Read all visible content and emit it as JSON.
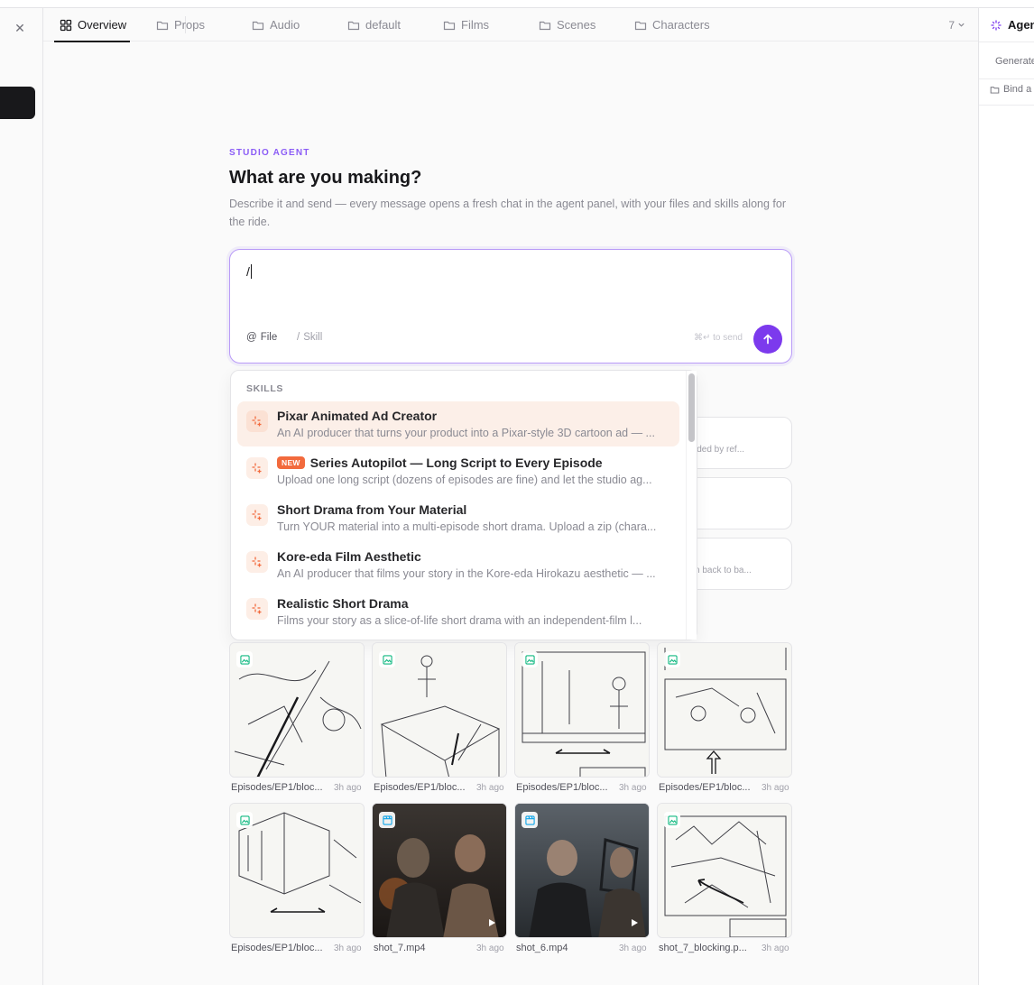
{
  "tabs": [
    {
      "label": "Overview",
      "icon": "grid-icon",
      "active": true
    },
    {
      "label": "Props",
      "icon": "folder-icon"
    },
    {
      "label": "Audio",
      "icon": "folder-icon"
    },
    {
      "label": "default",
      "icon": "folder-icon"
    },
    {
      "label": "Films",
      "icon": "folder-icon"
    },
    {
      "label": "Scenes",
      "icon": "folder-icon"
    },
    {
      "label": "Characters",
      "icon": "folder-icon"
    }
  ],
  "tab_overflow_count": "7",
  "right_panel": {
    "title": "Agent",
    "generate_label": "Generate",
    "bind_label": "Bind a"
  },
  "hero": {
    "kicker": "STUDIO AGENT",
    "title": "What are you making?",
    "description": "Describe it and send — every message opens a fresh chat in the agent panel, with your files and skills along for the ride."
  },
  "composer": {
    "value": "/",
    "file_label": "File",
    "skill_label": "Skill",
    "send_hint": "⌘↵ to send"
  },
  "background_cards": [
    {
      "text": "ided by ref..."
    },
    {
      "text": ""
    },
    {
      "text": "n back to ba..."
    }
  ],
  "skills": {
    "label": "SKILLS",
    "items": [
      {
        "title": "Pixar Animated Ad Creator",
        "badge": "",
        "desc": "An AI producer that turns your product into a Pixar-style 3D cartoon ad — ...",
        "active": true
      },
      {
        "title": "Series Autopilot — Long Script to Every Episode",
        "badge": "NEW",
        "desc": "Upload one long script (dozens of episodes are fine) and let the studio ag..."
      },
      {
        "title": "Short Drama from Your Material",
        "badge": "",
        "desc": "Turn YOUR material into a multi-episode short drama. Upload a zip (chara..."
      },
      {
        "title": "Kore-eda Film Aesthetic",
        "badge": "",
        "desc": "An AI producer that films your story in the Kore-eda Hirokazu aesthetic — ..."
      },
      {
        "title": "Realistic Short Drama",
        "badge": "",
        "desc": "Films your story as a slice-of-life short drama with an independent-film l..."
      }
    ]
  },
  "files": [
    {
      "name": "Episodes/EP1/bloc...",
      "time": "3h ago",
      "kind": "image"
    },
    {
      "name": "Episodes/EP1/bloc...",
      "time": "3h ago",
      "kind": "image"
    },
    {
      "name": "Episodes/EP1/bloc...",
      "time": "3h ago",
      "kind": "image"
    },
    {
      "name": "Episodes/EP1/bloc...",
      "time": "3h ago",
      "kind": "image"
    },
    {
      "name": "Episodes/EP1/bloc...",
      "time": "3h ago",
      "kind": "image"
    },
    {
      "name": "shot_7.mp4",
      "time": "3h ago",
      "kind": "video"
    },
    {
      "name": "shot_6.mp4",
      "time": "3h ago",
      "kind": "video"
    },
    {
      "name": "shot_7_blocking.p...",
      "time": "3h ago",
      "kind": "image"
    }
  ],
  "colors": {
    "accent": "#7c3aed",
    "kicker": "#8b5cf6",
    "skill_icon": "#f26a3d",
    "new_badge": "#f26a3d",
    "image_badge": "#10b981",
    "video_badge": "#0ea5e9"
  }
}
